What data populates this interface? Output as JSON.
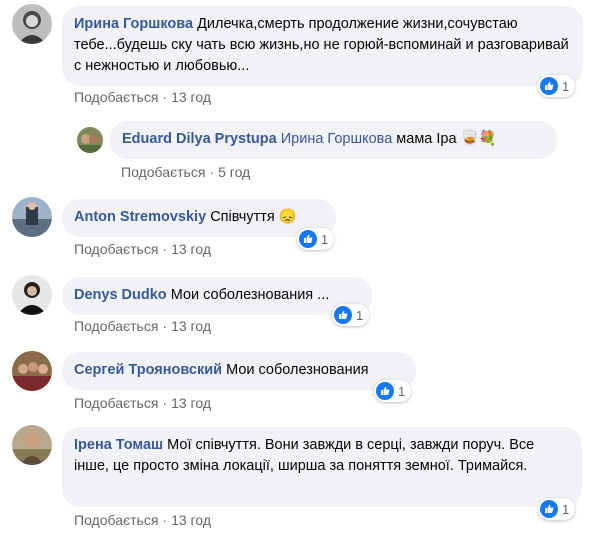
{
  "comments": [
    {
      "author": "Ирина Горшкова",
      "text": "Дилечка,смерть продолжение жизни,сочувстаю тебе...будешь ску чать всю жизнь,но не горюй-вспоминай и разговаривай с нежностью и любовью...",
      "like_label": "Подобається",
      "time": "13 год",
      "reaction_count": "1"
    },
    {
      "author": "Eduard Dilya Prystupa",
      "mention": "Ирина Горшкова",
      "text": "мама Іра",
      "emoji": "🥃💐",
      "like_label": "Подобається",
      "time": "5 год"
    },
    {
      "author": "Anton Stremovskiy",
      "text": "Співчуття",
      "emoji": "😞",
      "like_label": "Подобається",
      "time": "13 год",
      "reaction_count": "1"
    },
    {
      "author": "Denys Dudko",
      "text": "Мои соболезнования ...",
      "like_label": "Подобається",
      "time": "13 год",
      "reaction_count": "1"
    },
    {
      "author": "Сергей Трояновский",
      "text": "Мои соболезнования",
      "like_label": "Подобається",
      "time": "13 год",
      "reaction_count": "1"
    },
    {
      "author": "Ірена Томаш",
      "text": "Мої співчуття. Вони завжди в серці, завжди поруч. Все інше, це просто зміна локації, ширша за поняття земної. Тримайся.",
      "like_label": "Подобається",
      "time": "13 год",
      "reaction_count": "1"
    }
  ],
  "icons": {
    "like": "thumbs-up-icon",
    "separator": "·"
  },
  "colors": {
    "author": "#385898",
    "bubble": "#f0f2f5",
    "meta": "#65676b",
    "like": "#1877f2"
  }
}
